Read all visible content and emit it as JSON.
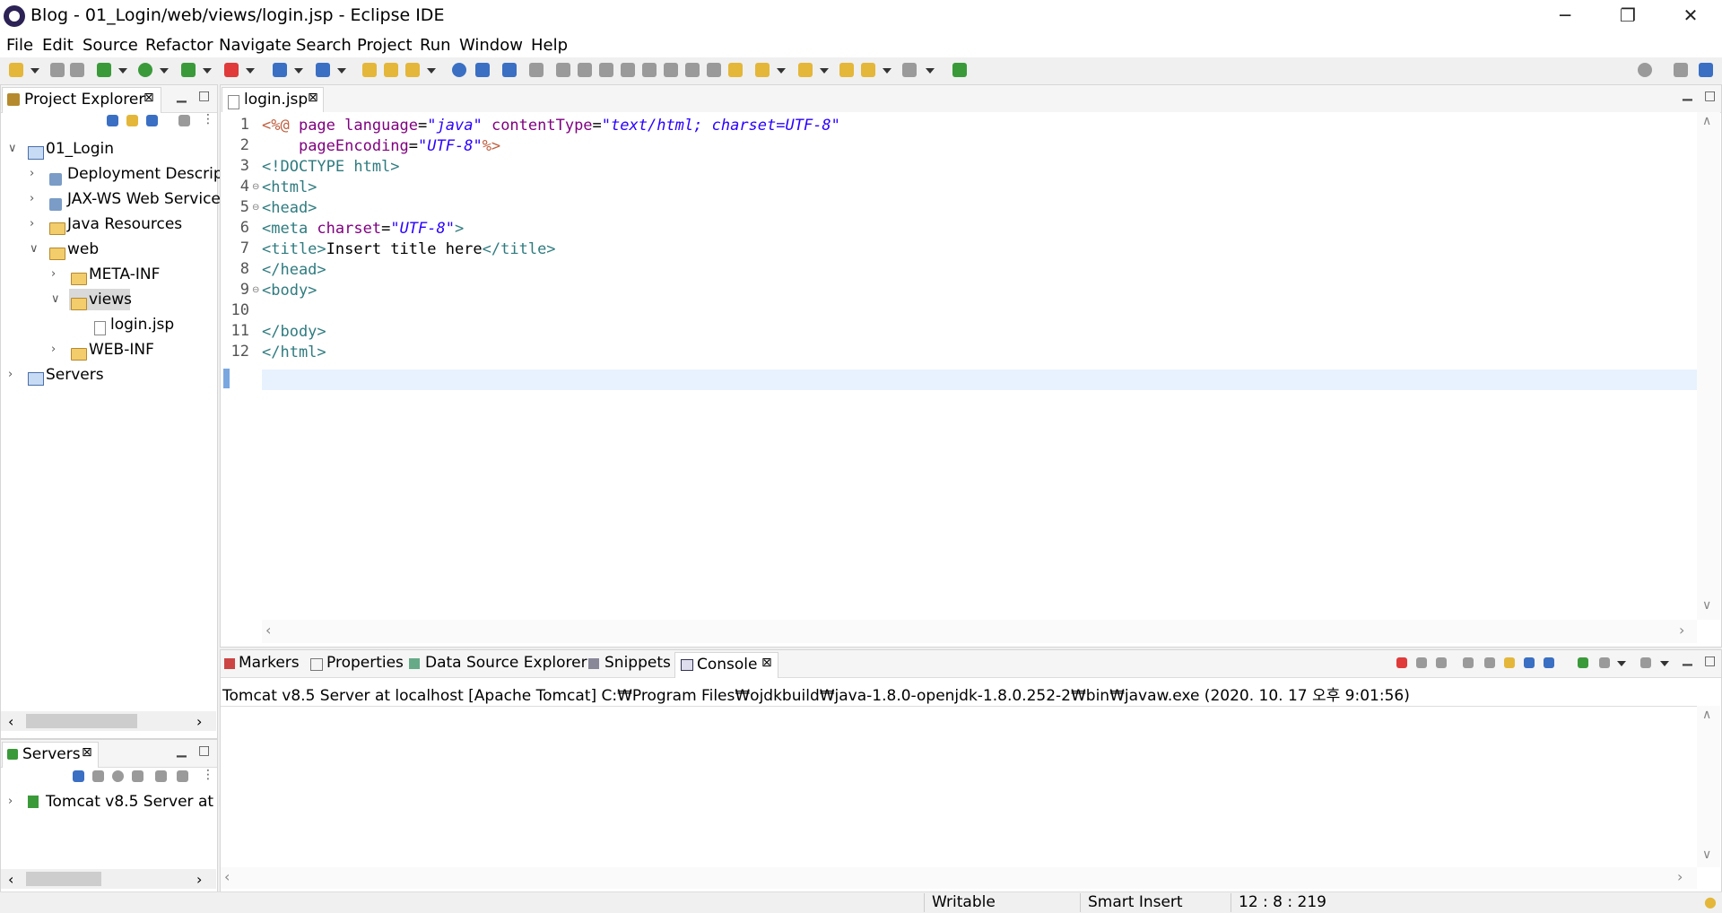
{
  "window": {
    "title": "Blog - 01_Login/web/views/login.jsp - Eclipse IDE",
    "minimize": "─",
    "restore": "❐",
    "close": "✕"
  },
  "menu": [
    "File",
    "Edit",
    "Source",
    "Refactor",
    "Navigate",
    "Search",
    "Project",
    "Run",
    "Window",
    "Help"
  ],
  "project_explorer": {
    "title": "Project Explorer",
    "close": "⊠",
    "tree": [
      {
        "label": "01_Login"
      },
      {
        "label": "Deployment Descrip"
      },
      {
        "label": "JAX-WS Web Service"
      },
      {
        "label": "Java Resources"
      },
      {
        "label": "web"
      },
      {
        "label": "META-INF"
      },
      {
        "label": "views"
      },
      {
        "label": "login.jsp"
      },
      {
        "label": "WEB-INF"
      },
      {
        "label": "Servers"
      }
    ]
  },
  "servers_view": {
    "title": "Servers",
    "close": "⊠",
    "item": "Tomcat v8.5 Server at l"
  },
  "editor": {
    "tab_label": "login.jsp",
    "tab_close": "⊠",
    "line_numbers": [
      "1",
      "2",
      "3",
      "4",
      "5",
      "6",
      "7",
      "8",
      "9",
      "10",
      "11",
      "12"
    ],
    "lines": [
      [
        "<%@ ",
        "page ",
        "language",
        "=",
        "\"java\"",
        " ",
        "contentType",
        "=",
        "\"text/html; charset=UTF-8\""
      ],
      [
        "    ",
        "pageEncoding",
        "=",
        "\"UTF-8\"",
        "%>"
      ],
      [
        "<!DOCTYPE html>"
      ],
      [
        "<html>"
      ],
      [
        "<head>"
      ],
      [
        "<meta ",
        "charset",
        "=",
        "\"UTF-8\"",
        ">"
      ],
      [
        "<title>",
        "Insert title here",
        "</title>"
      ],
      [
        "</head>"
      ],
      [
        "<body>"
      ],
      [
        ""
      ],
      [
        "</body>"
      ],
      [
        "</html>"
      ]
    ]
  },
  "bottom_tabs": [
    "Markers",
    "Properties",
    "Data Source Explorer",
    "Snippets",
    "Console"
  ],
  "console": {
    "close": "⊠",
    "description": "Tomcat v8.5 Server at localhost [Apache Tomcat] C:₩Program Files₩ojdkbuild₩java-1.8.0-openjdk-1.8.0.252-2₩bin₩javaw.exe  (2020. 10. 17 오후 9:01:56)"
  },
  "status_bar": {
    "writable": "Writable",
    "insert_mode": "Smart Insert",
    "position": "12 : 8 : 219"
  }
}
